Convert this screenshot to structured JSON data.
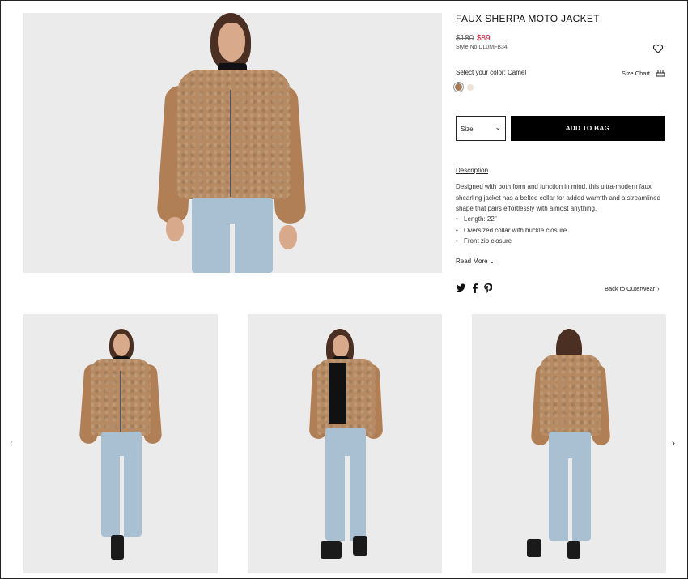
{
  "product": {
    "title": "FAUX SHERPA MOTO JACKET",
    "price_original": "$180",
    "price_sale": "$89",
    "style_no": "Style No DL0MFB34"
  },
  "colors": {
    "label": "Select your color: Camel",
    "swatches": [
      {
        "name": "Camel",
        "hex": "#a67b57",
        "selected": true
      },
      {
        "name": "Cream",
        "hex": "#eee3d8",
        "selected": false
      }
    ]
  },
  "size_chart_label": "Size Chart",
  "size_select": {
    "value": "Size"
  },
  "add_to_bag_label": "ADD TO BAG",
  "description": {
    "heading": "Description",
    "text": "Designed with both form and function in mind, this ultra-modern faux shearling jacket has a belted collar for added warmth and a streamlined shape that pairs effortlessly with almost anything.",
    "bullets": [
      "Length: 22\"",
      "Oversized collar with buckle closure",
      "Front zip closure"
    ],
    "read_more": "Read More"
  },
  "back_link": "Back to Outerwear",
  "icons": {
    "wishlist": "heart-icon",
    "size_chart": "ruler-icon",
    "twitter": "twitter-icon",
    "facebook": "facebook-icon",
    "pinterest": "pinterest-icon",
    "prev": "chevron-left-icon",
    "next": "chevron-right-icon"
  },
  "accent_colors": {
    "sale_price": "#c8102e",
    "button": "#000000"
  }
}
